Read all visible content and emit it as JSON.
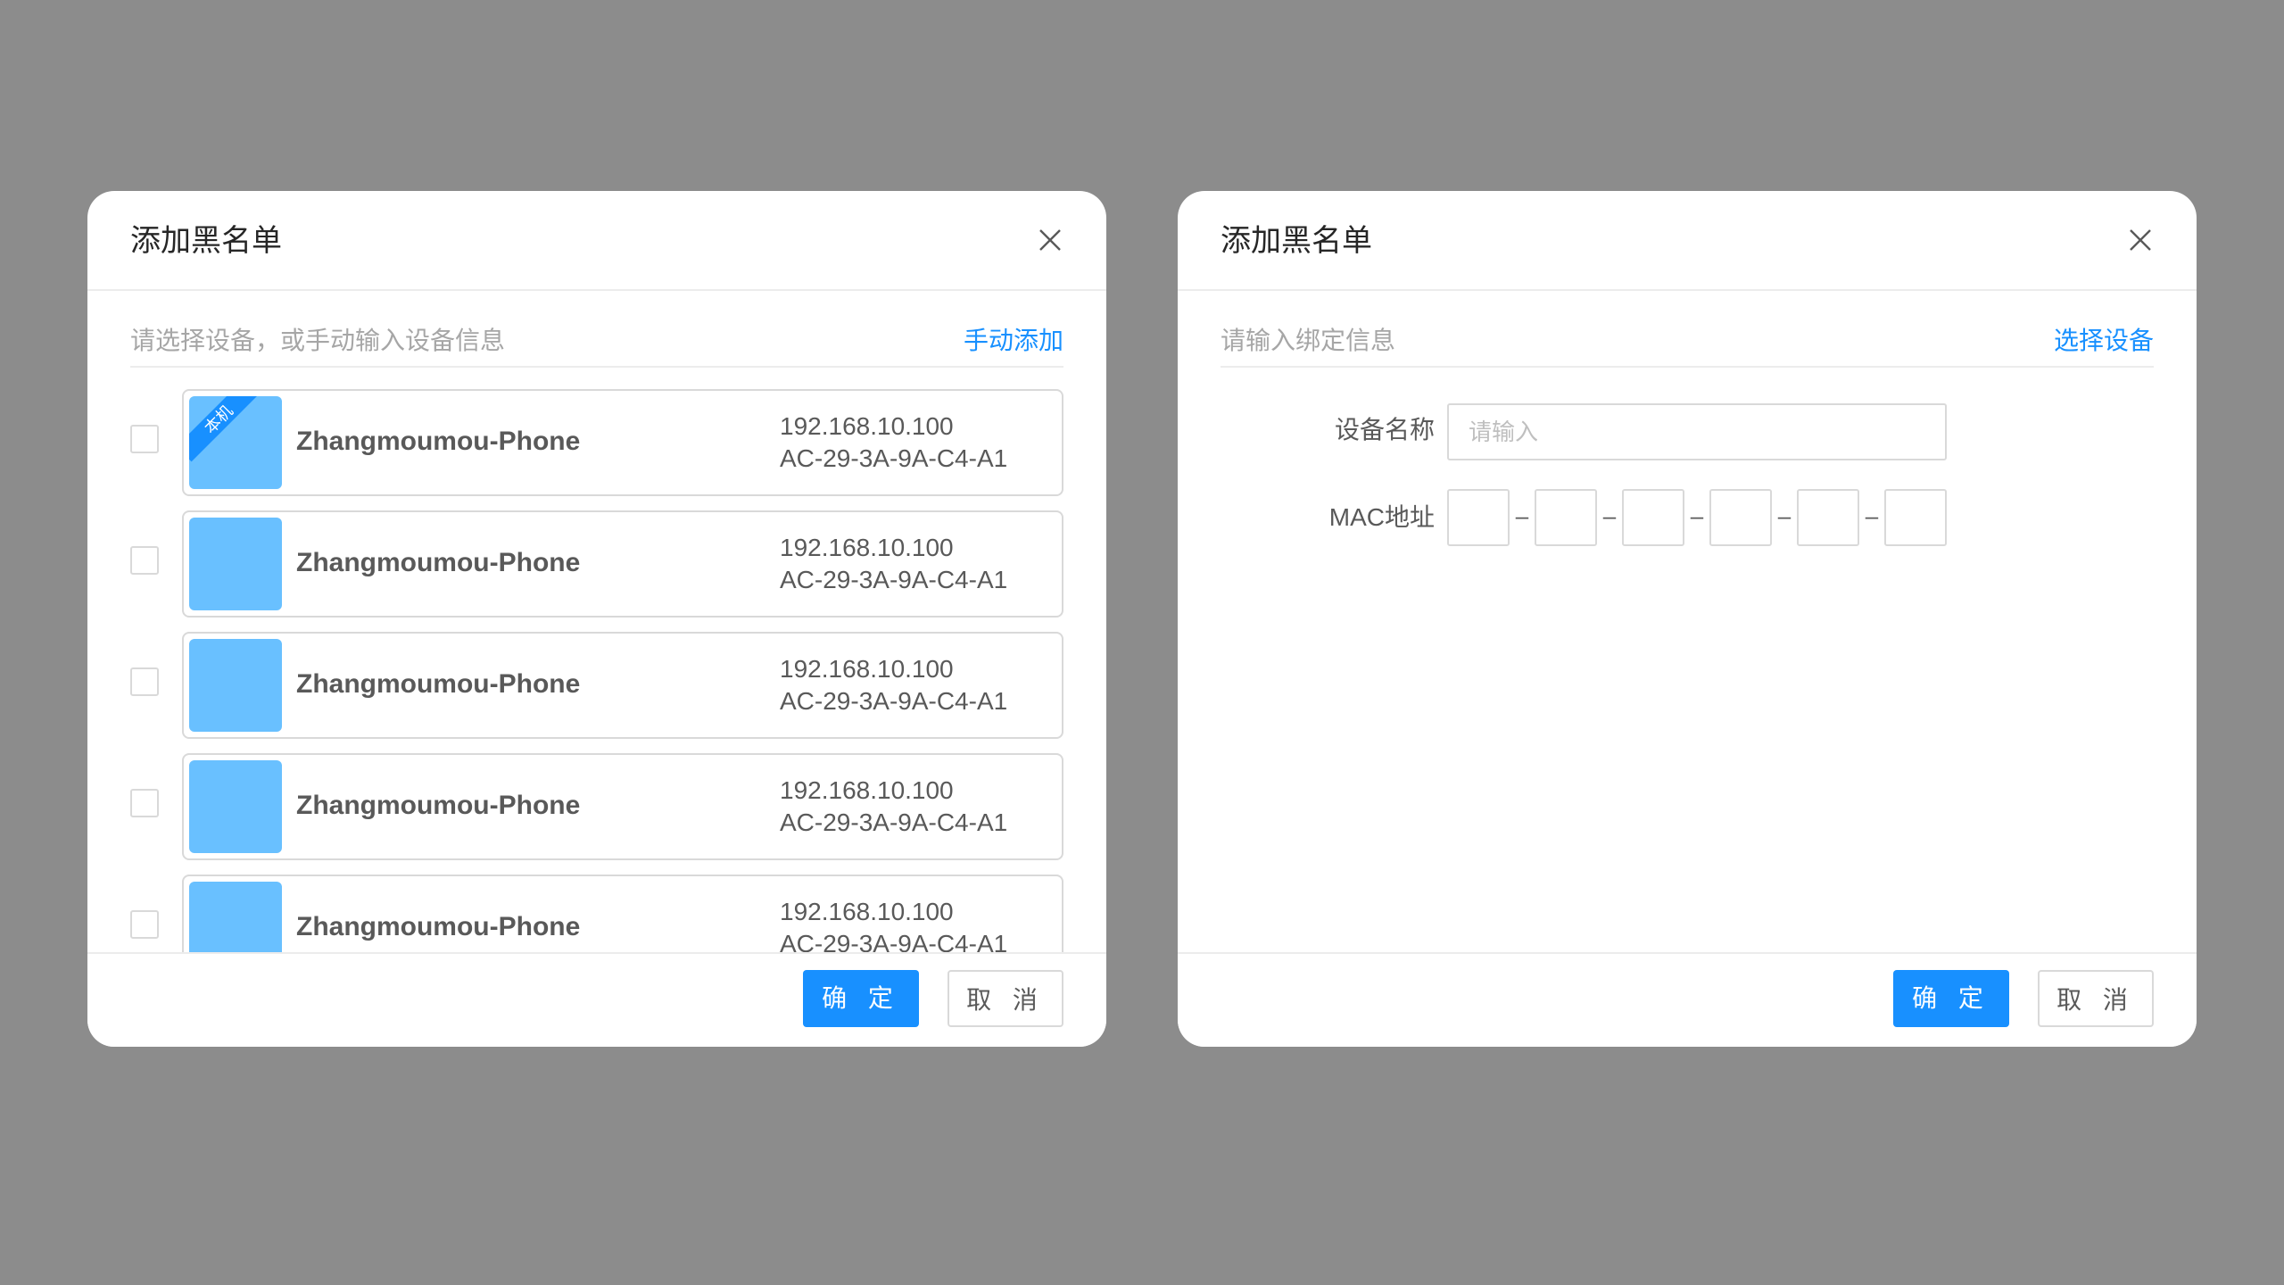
{
  "left_dialog": {
    "title": "添加黑名单",
    "hint": "请选择设备，或手动输入设备信息",
    "link": "手动添加",
    "local_tag": "本机",
    "devices": [
      {
        "name": "Zhangmoumou-Phone",
        "ip": "192.168.10.100",
        "mac": "AC-29-3A-9A-C4-A1",
        "is_local": true
      },
      {
        "name": "Zhangmoumou-Phone",
        "ip": "192.168.10.100",
        "mac": "AC-29-3A-9A-C4-A1",
        "is_local": false
      },
      {
        "name": "Zhangmoumou-Phone",
        "ip": "192.168.10.100",
        "mac": "AC-29-3A-9A-C4-A1",
        "is_local": false
      },
      {
        "name": "Zhangmoumou-Phone",
        "ip": "192.168.10.100",
        "mac": "AC-29-3A-9A-C4-A1",
        "is_local": false
      },
      {
        "name": "Zhangmoumou-Phone",
        "ip": "192.168.10.100",
        "mac": "AC-29-3A-9A-C4-A1",
        "is_local": false
      }
    ],
    "ok_label": "确 定",
    "cancel_label": "取 消"
  },
  "right_dialog": {
    "title": "添加黑名单",
    "hint": "请输入绑定信息",
    "link": "选择设备",
    "device_name_label": "设备名称",
    "device_name_placeholder": "请输入",
    "mac_label": "MAC地址",
    "mac_separator": "–",
    "ok_label": "确 定",
    "cancel_label": "取 消"
  },
  "colors": {
    "backdrop": "#8c8c8c",
    "primary": "#1890ff",
    "thumbnail": "#69c0ff"
  },
  "icons": {
    "close": "close-icon"
  }
}
